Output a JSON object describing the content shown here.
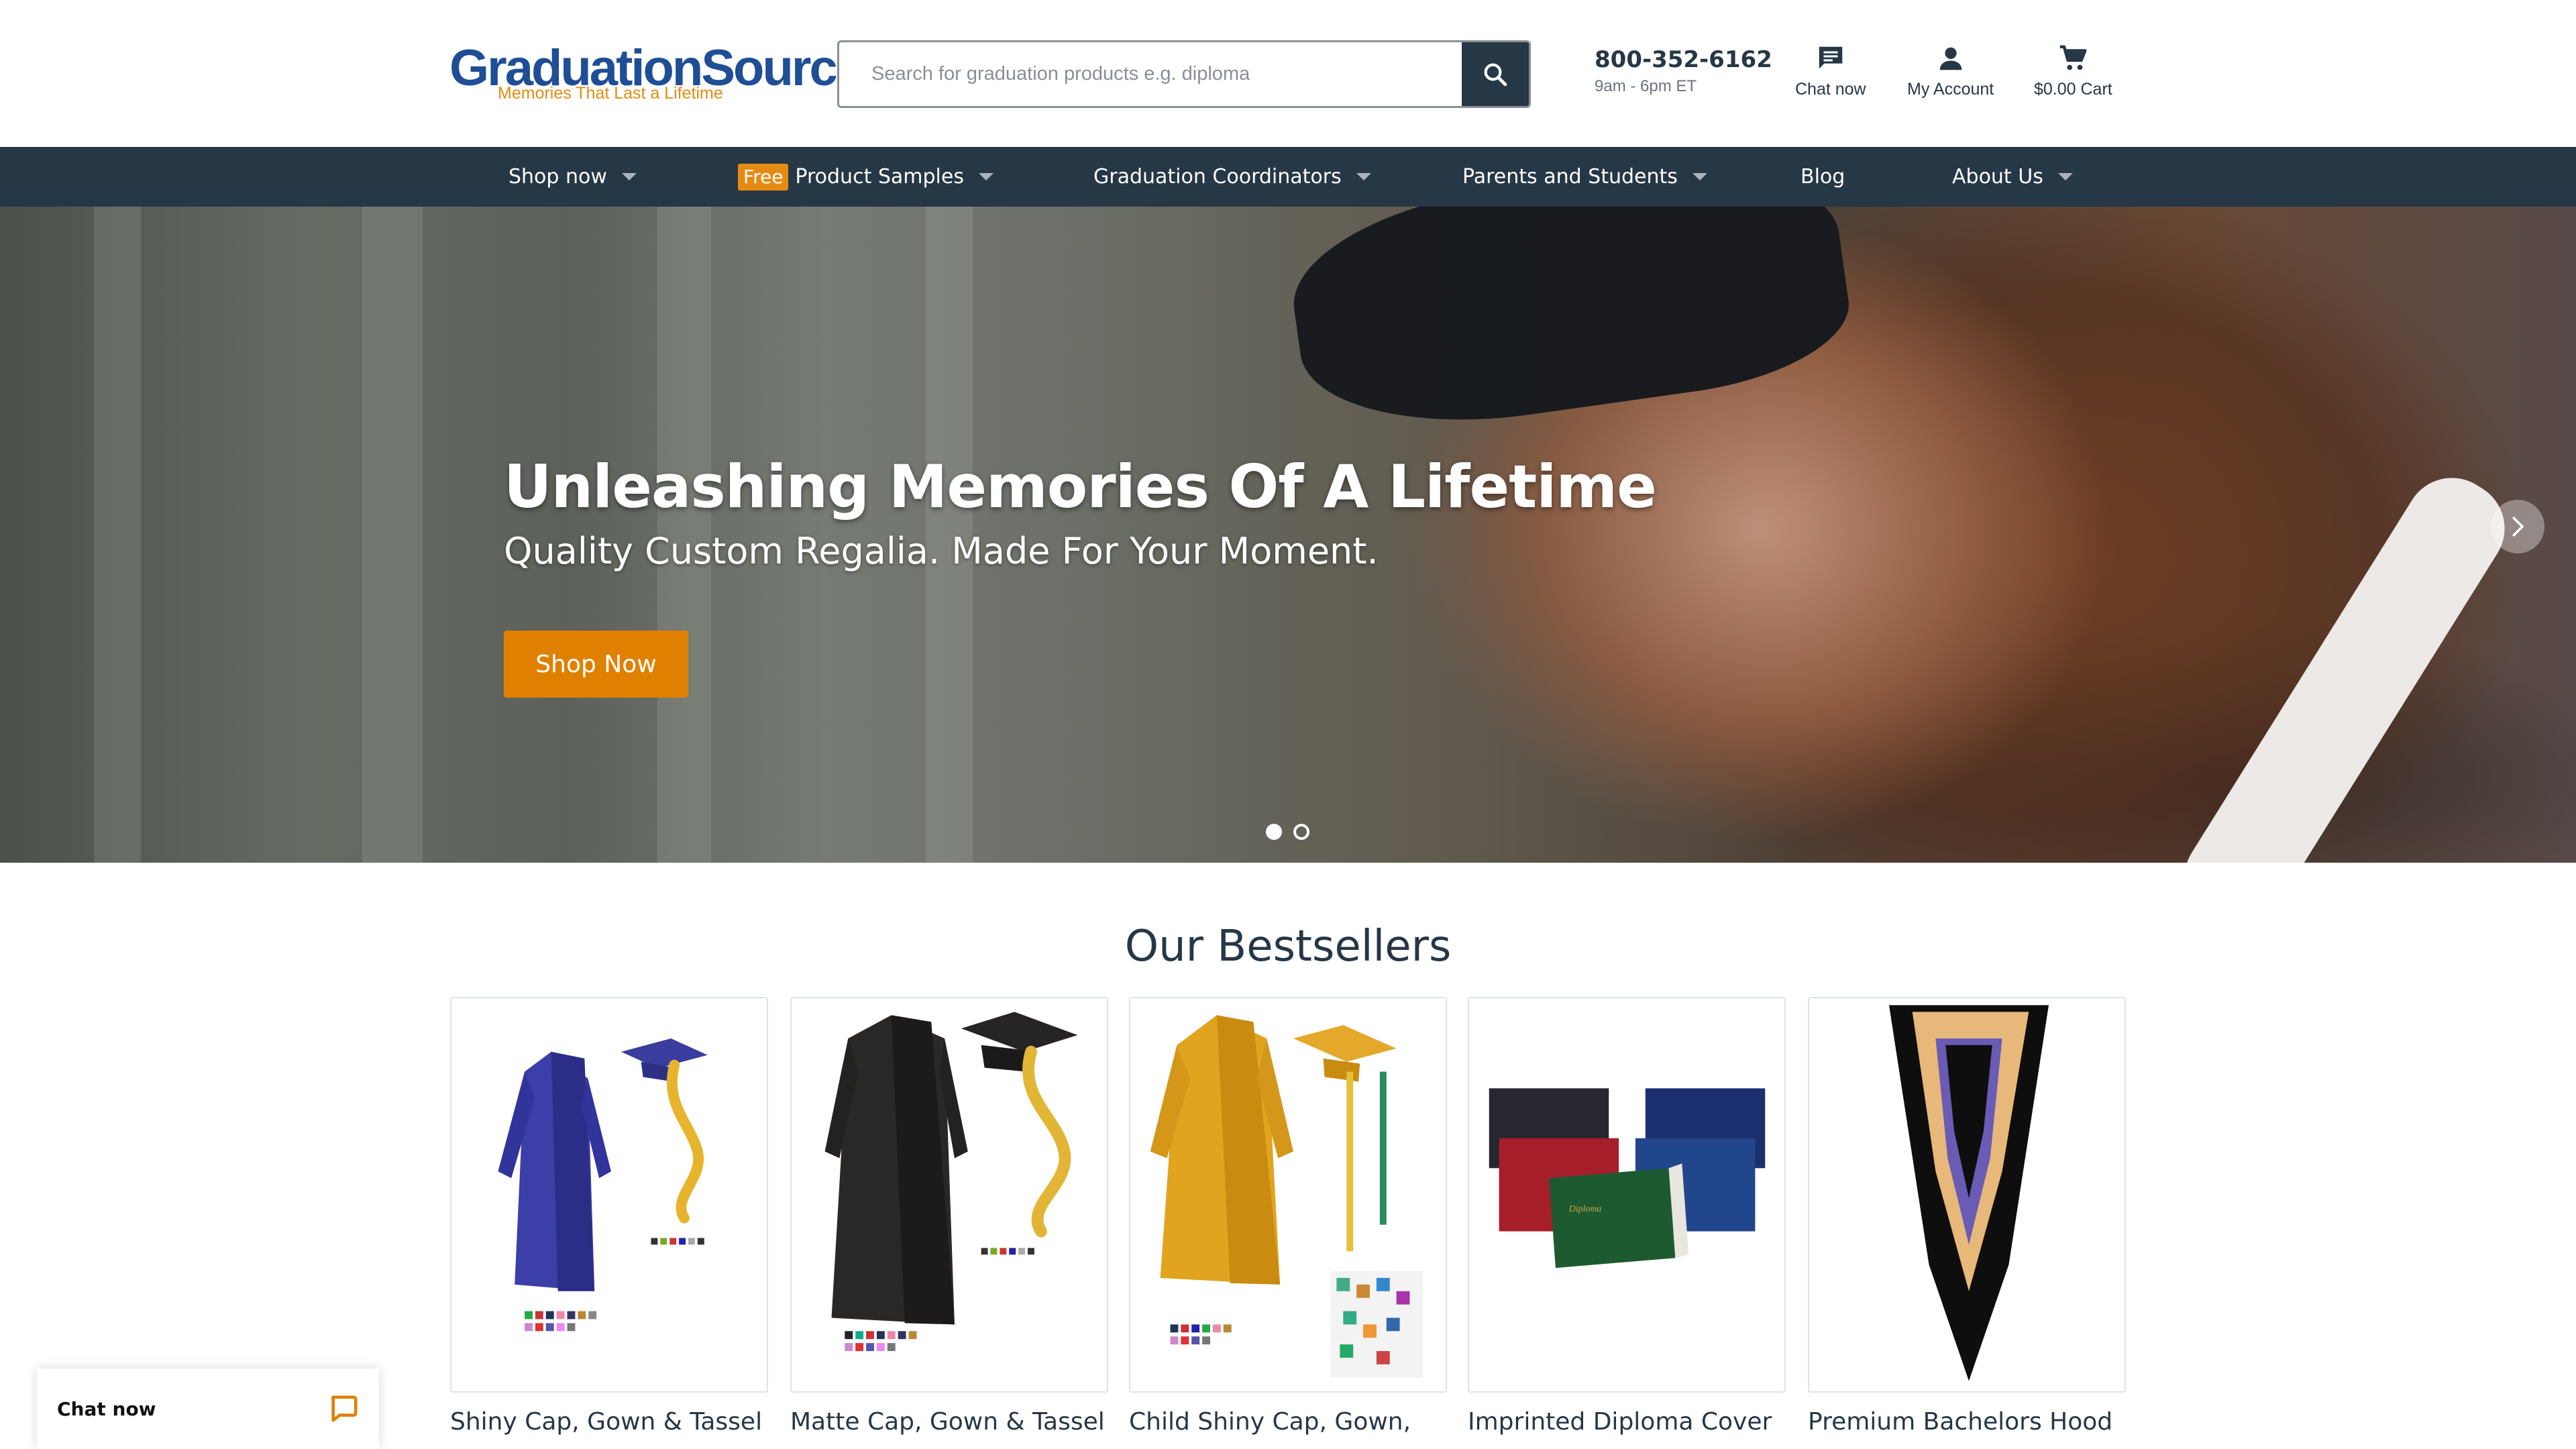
{
  "header": {
    "logo_main": "GraduationSource",
    "logo_tagline": "Memories That Last a Lifetime",
    "search_placeholder": "Search for graduation products e.g. diploma",
    "phone": "800-352-6162",
    "hours": "9am - 6pm ET",
    "chat_label": "Chat now",
    "account_label": "My Account",
    "cart_label": "$0.00 Cart",
    "icons": [
      "search-icon",
      "chat-icon",
      "account-icon",
      "cart-icon"
    ]
  },
  "nav": {
    "items": [
      {
        "label": "Shop now",
        "has_dropdown": true
      },
      {
        "badge": "Free",
        "label": "Product Samples",
        "has_dropdown": true
      },
      {
        "label": "Graduation Coordinators",
        "has_dropdown": true
      },
      {
        "label": "Parents and Students",
        "has_dropdown": true
      },
      {
        "label": "Blog",
        "has_dropdown": false
      },
      {
        "label": "About Us",
        "has_dropdown": true
      }
    ]
  },
  "hero": {
    "title": "Unleashing Memories Of A Lifetime",
    "subtitle": "Quality Custom Regalia. Made For Your Moment.",
    "cta": "Shop Now",
    "slide_count": 2,
    "active_slide": 1
  },
  "bestsellers": {
    "title": "Our Bestsellers",
    "products": [
      {
        "name": "Shiny Cap, Gown & Tassel",
        "image": "blue shiny gown, cap and gold tassel"
      },
      {
        "name": "Matte Cap, Gown & Tassel",
        "image": "black matte gown, cap and gold tassel"
      },
      {
        "name": "Child Shiny Cap, Gown,",
        "image": "gold child gown, cap and tassel"
      },
      {
        "name": "Imprinted Diploma Cover",
        "image": "diploma covers in several colors"
      },
      {
        "name": "Premium Bachelors Hood",
        "image": "black hood with gold and purple lining"
      }
    ]
  },
  "chat_widget": {
    "label": "Chat now"
  },
  "colors": {
    "brand_navy": "#263746",
    "logo_blue": "#1f4e96",
    "accent_orange": "#e08000",
    "text": "#263746"
  }
}
